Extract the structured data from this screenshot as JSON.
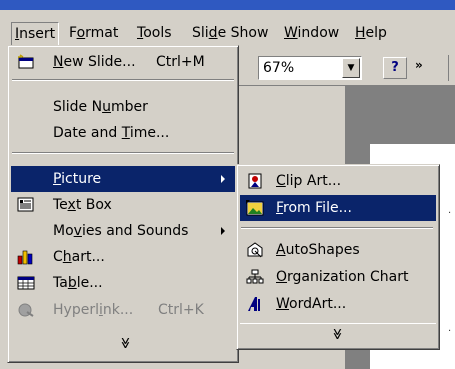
{
  "menubar": {
    "items": [
      {
        "label": "Insert",
        "active": true
      },
      {
        "label": "Format"
      },
      {
        "label": "Tools"
      },
      {
        "label": "Slide Show"
      },
      {
        "label": "Window"
      },
      {
        "label": "Help"
      }
    ]
  },
  "toolbar": {
    "zoom_value": "67%",
    "help_glyph": "?",
    "more_glyph": "»"
  },
  "insert_menu": {
    "items": [
      {
        "label": "New Slide...",
        "shortcut": "Ctrl+M",
        "icon": "new-slide-icon"
      },
      {
        "label": "Slide Number"
      },
      {
        "label": "Date and Time..."
      },
      {
        "label": "Picture",
        "submenu": true,
        "selected": true
      },
      {
        "label": "Text Box",
        "icon": "text-box-icon"
      },
      {
        "label": "Movies and Sounds",
        "submenu": true
      },
      {
        "label": "Chart...",
        "icon": "chart-icon"
      },
      {
        "label": "Table...",
        "icon": "table-icon"
      },
      {
        "label": "Hyperlink...",
        "shortcut": "Ctrl+K",
        "icon": "hyperlink-icon",
        "disabled": true
      }
    ],
    "expand_glyph": "≫"
  },
  "picture_submenu": {
    "items": [
      {
        "label": "Clip Art...",
        "icon": "clip-art-icon"
      },
      {
        "label": "From File...",
        "icon": "from-file-icon",
        "selected": true
      },
      {
        "label": "AutoShapes",
        "icon": "autoshapes-icon"
      },
      {
        "label": "Organization Chart",
        "icon": "org-chart-icon"
      },
      {
        "label": "WordArt...",
        "icon": "wordart-icon"
      }
    ],
    "expand_glyph": "≫"
  },
  "colors": {
    "selection": "#0a246a",
    "menu_face": "#d4d0c8",
    "title_bar": "#2f59c1"
  }
}
